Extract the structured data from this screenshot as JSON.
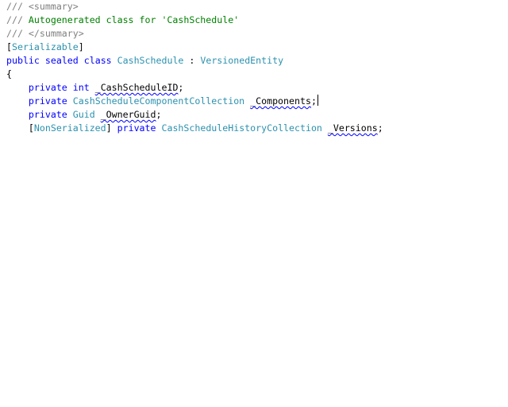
{
  "editor": {
    "lines": [
      {
        "tokens": [
          [
            "cm",
            "/// "
          ],
          [
            "cm",
            "<summary>"
          ]
        ]
      },
      {
        "tokens": [
          [
            "cm",
            "/// "
          ],
          [
            "cm-text",
            "Autogenerated class for 'CashSchedule'"
          ]
        ]
      },
      {
        "tokens": [
          [
            "cm",
            "/// "
          ],
          [
            "cm",
            "</summary>"
          ]
        ]
      },
      {
        "tokens": [
          [
            "plain",
            "["
          ],
          [
            "type",
            "Serializable"
          ],
          [
            "plain",
            "]"
          ]
        ]
      },
      {
        "tokens": [
          [
            "kw",
            "public"
          ],
          [
            "plain",
            " "
          ],
          [
            "kw",
            "sealed"
          ],
          [
            "plain",
            " "
          ],
          [
            "kw",
            "class"
          ],
          [
            "plain",
            " "
          ],
          [
            "type",
            "CashSchedule"
          ],
          [
            "plain",
            " : "
          ],
          [
            "type",
            "VersionedEntity"
          ]
        ]
      },
      {
        "tokens": [
          [
            "plain",
            "{"
          ]
        ]
      },
      {
        "tokens": [
          [
            "plain",
            "    "
          ],
          [
            "kw",
            "private"
          ],
          [
            "plain",
            " "
          ],
          [
            "kw",
            "int"
          ],
          [
            "plain",
            " "
          ],
          [
            "squig",
            "_CashScheduleID"
          ],
          [
            "plain",
            ";"
          ]
        ]
      },
      {
        "tokens": [
          [
            "plain",
            "    "
          ],
          [
            "kw",
            "private"
          ],
          [
            "plain",
            " "
          ],
          [
            "type",
            "CashScheduleComponentCollection"
          ],
          [
            "plain",
            " "
          ],
          [
            "squig",
            "_Components"
          ],
          [
            "plain",
            ";"
          ],
          [
            "caret",
            ""
          ]
        ]
      },
      {
        "tokens": [
          [
            "plain",
            "    "
          ],
          [
            "kw",
            "private"
          ],
          [
            "plain",
            " "
          ],
          [
            "type",
            "Guid"
          ],
          [
            "plain",
            " "
          ],
          [
            "squig",
            "_OwnerGuid"
          ],
          [
            "plain",
            ";"
          ]
        ]
      },
      {
        "tokens": [
          [
            "plain",
            "    "
          ],
          [
            "plain",
            "["
          ],
          [
            "type",
            "NonSerialized"
          ],
          [
            "plain",
            "] "
          ],
          [
            "kw",
            "private"
          ],
          [
            "plain",
            " "
          ],
          [
            "type",
            "CashScheduleHistoryCollection"
          ],
          [
            "plain",
            " "
          ],
          [
            "squig",
            "_Versions"
          ],
          [
            "plain",
            ";"
          ]
        ]
      }
    ]
  }
}
